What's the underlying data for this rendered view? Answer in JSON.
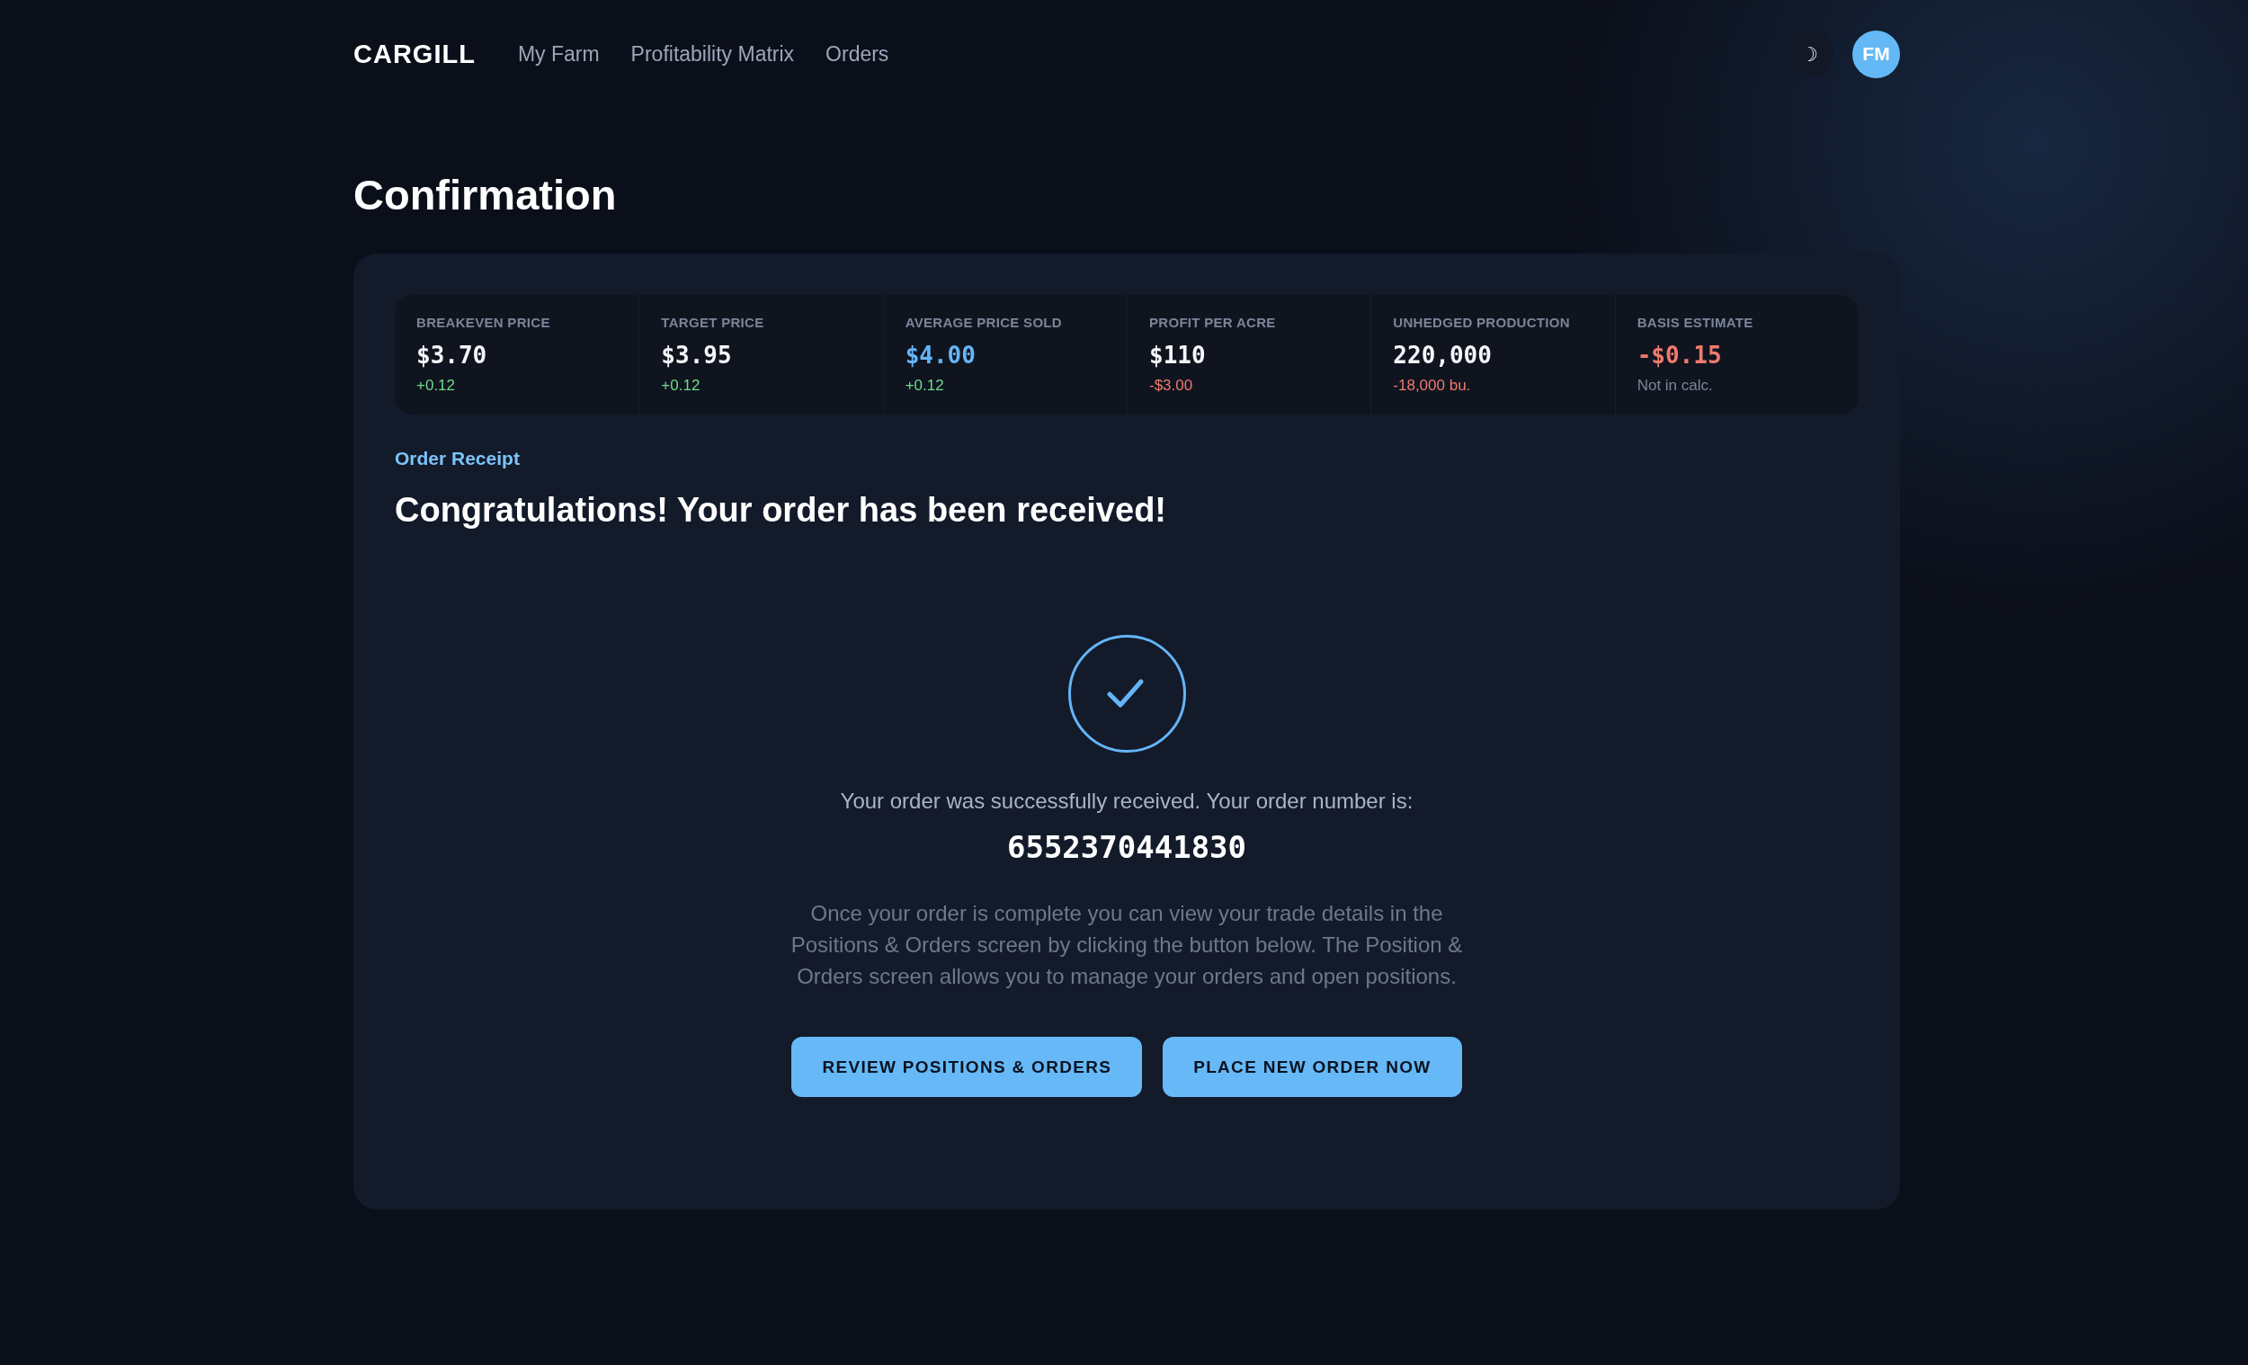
{
  "header": {
    "logo": "CARGILL",
    "nav": [
      {
        "label": "My Farm"
      },
      {
        "label": "Profitability Matrix"
      },
      {
        "label": "Orders"
      }
    ],
    "theme_toggle": {
      "symbol": "☽"
    },
    "avatar": {
      "initials": "FM"
    }
  },
  "page_title": "Confirmation",
  "metrics": [
    {
      "label": "BREAKEVEN PRICE",
      "value": {
        "text": "$3.70",
        "color": "#f4f6fa"
      },
      "change": {
        "text": "+0.12",
        "color": "#6fdc8c"
      }
    },
    {
      "label": "TARGET PRICE",
      "value": {
        "text": "$3.95",
        "color": "#f4f6fa"
      },
      "change": {
        "text": "+0.12",
        "color": "#6fdc8c"
      }
    },
    {
      "label": "AVERAGE PRICE SOLD",
      "value": {
        "text": "$4.00",
        "color": "#64b5f6"
      },
      "change": {
        "text": "+0.12",
        "color": "#6fdc8c"
      }
    },
    {
      "label": "PROFIT PER ACRE",
      "value": {
        "text": "$110",
        "color": "#f4f6fa"
      },
      "change": {
        "text": "-$3.00",
        "color": "#f07a6e"
      }
    },
    {
      "label": "UNHEDGED PRODUCTION",
      "value": {
        "text": "220,000",
        "color": "#f4f6fa"
      },
      "change": {
        "text": "-18,000 bu.",
        "color": "#f07a6e"
      }
    },
    {
      "label": "BASIS ESTIMATE",
      "value": {
        "text": "-$0.15",
        "color": "#f07a6e"
      },
      "change": {
        "text": "Not in calc.",
        "color": "#7b8599"
      }
    }
  ],
  "receipt": {
    "eyebrow": "Order Receipt",
    "heading": "Congratulations! Your order has been received!",
    "message": "Your order was successfully received. Your order number is:",
    "order_number": "6552370441830",
    "details": "Once your order is complete you can view your trade details in the Positions & Orders screen by clicking the button below. The Position & Orders screen allows you to manage your orders and open positions.",
    "buttons": [
      {
        "label": "REVIEW POSITIONS & ORDERS"
      },
      {
        "label": "PLACE NEW ORDER NOW"
      }
    ]
  }
}
